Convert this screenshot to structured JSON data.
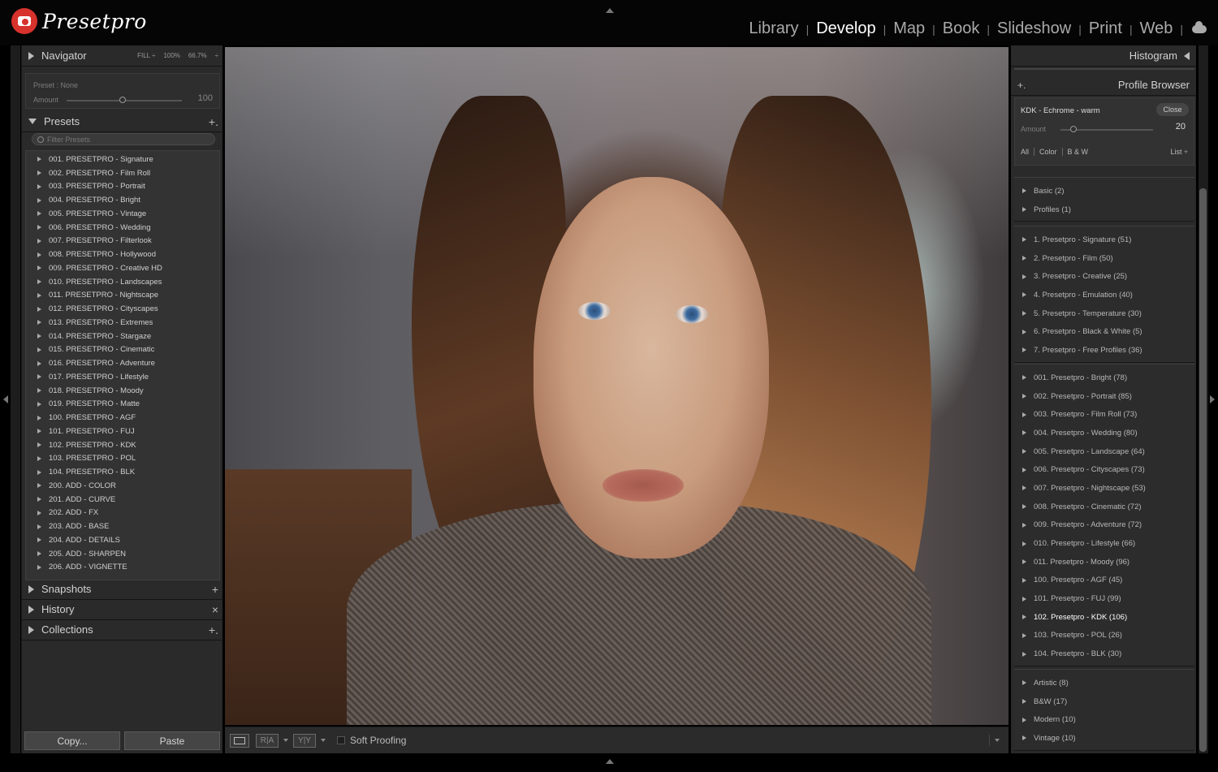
{
  "app": {
    "logo_text": "Presetpro"
  },
  "modules": [
    "Library",
    "Develop",
    "Map",
    "Book",
    "Slideshow",
    "Print",
    "Web"
  ],
  "active_module": "Develop",
  "cloud_icon": "cloud-icon",
  "navigator": {
    "title": "Navigator",
    "fill": "FILL ÷",
    "z100": "100%",
    "z667": "66.7%",
    "more": "÷"
  },
  "preset_amount": {
    "label": "Preset : None",
    "amount_label": "Amount",
    "value": "100"
  },
  "presets": {
    "title": "Presets",
    "add": "+.",
    "filter_placeholder": "Filter Presets",
    "items": [
      "001. PRESETPRO - Signature",
      "002. PRESETPRO - Film Roll",
      "003. PRESETPRO - Portrait",
      "004. PRESETPRO - Bright",
      "005. PRESETPRO - Vintage",
      "006. PRESETPRO - Wedding",
      "007. PRESETPRO - Filterlook",
      "008. PRESETPRO - Hollywood",
      "009. PRESETPRO - Creative HD",
      "010. PRESETPRO - Landscapes",
      "011. PRESETPRO - Nightscape",
      "012. PRESETPRO - Cityscapes",
      "013. PRESETPRO - Extremes",
      "014. PRESETPRO - Stargaze",
      "015. PRESETPRO - Cinematic",
      "016. PRESETPRO - Adventure",
      "017. PRESETPRO - Lifestyle",
      "018. PRESETPRO - Moody",
      "019. PRESETPRO - Matte",
      "100. PRESETPRO - AGF",
      "101. PRESETPRO - FUJ",
      "102. PRESETPRO - KDK",
      "103. PRESETPRO - POL",
      "104. PRESETPRO - BLK",
      "200. ADD - COLOR",
      "201. ADD - CURVE",
      "202. ADD - FX",
      "203. ADD - BASE",
      "204. ADD - DETAILS",
      "205. ADD - SHARPEN",
      "206. ADD - VIGNETTE"
    ]
  },
  "left_sections": [
    {
      "title": "Snapshots",
      "icon": "+"
    },
    {
      "title": "History",
      "icon": "×"
    },
    {
      "title": "Collections",
      "icon": "+."
    }
  ],
  "bottom_buttons": {
    "copy": "Copy...",
    "paste": "Paste"
  },
  "toolbar": {
    "view_a": "R|A",
    "view_b": "Y|Y",
    "soft_proofing": "Soft Proofing"
  },
  "right": {
    "histogram": "Histogram",
    "profile_browser": "Profile Browser",
    "add": "+.",
    "profile_name": "KDK - Echrome - warm",
    "close": "Close",
    "amount_label": "Amount",
    "amount_value": "20",
    "filters": [
      "All",
      "Color",
      "B & W"
    ],
    "view": "List ÷",
    "groups": [
      [
        "Basic (2)",
        "Profiles (1)"
      ],
      [
        "1. Presetpro - Signature (51)",
        "2. Presetpro - Film (50)",
        "3. Presetpro - Creative (25)",
        "4. Presetpro - Emulation (40)",
        "5. Presetpro - Temperature (30)",
        "6. Presetpro - Black & White (5)",
        "7. Presetpro - Free Profiles (36)"
      ],
      [
        "001. Presetpro - Bright (78)",
        "002. Presetpro - Portrait (85)",
        "003. Presetpro - Film Roll (73)",
        "004. Presetpro - Wedding (80)",
        "005. Presetpro - Landscape (64)",
        "006. Presetpro - Cityscapes (73)",
        "007. Presetpro - Nightscape (53)",
        "008. Presetpro - Cinematic (72)",
        "009. Presetpro - Adventure (72)",
        "010. Presetpro - Lifestyle (66)",
        "011. Presetpro - Moody (96)",
        "100. Presetpro - AGF (45)",
        "101. Presetpro - FUJ (99)",
        "102. Presetpro - KDK (106)",
        "103. Presetpro - POL (26)",
        "104. Presetpro - BLK (30)"
      ],
      [
        "Artistic (8)",
        "B&W (17)",
        "Modern (10)",
        "Vintage (10)"
      ]
    ],
    "highlighted": "102. Presetpro - KDK (106)"
  },
  "colors": {
    "accent": "#d8322d",
    "panel": "#2a2a2a",
    "background": "#000000"
  }
}
